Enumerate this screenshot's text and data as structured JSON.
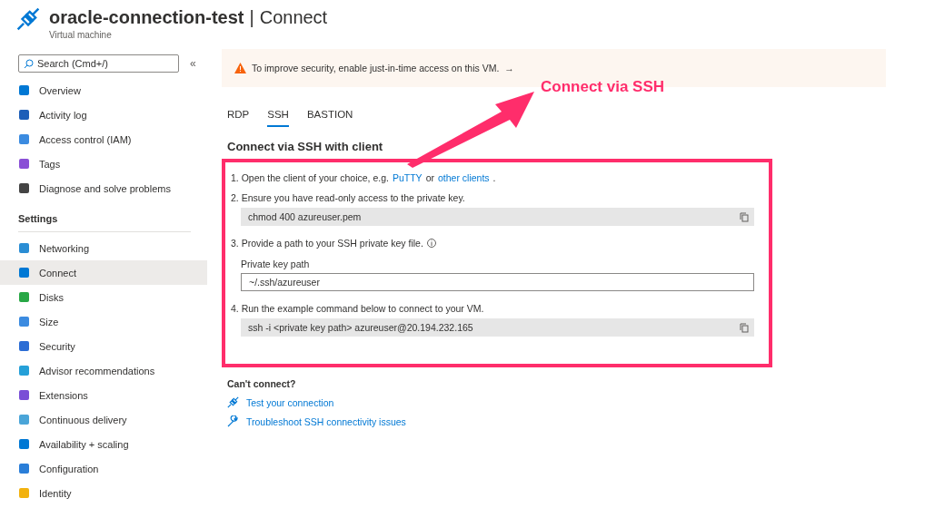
{
  "header": {
    "title": "oracle-connection-test",
    "separator": "|",
    "page": "Connect",
    "subtitle": "Virtual machine"
  },
  "sidebar": {
    "search": {
      "placeholder": "Search (Cmd+/)"
    },
    "collapse": "«",
    "items": [
      {
        "label": "Overview",
        "selected": false
      },
      {
        "label": "Activity log",
        "selected": false
      },
      {
        "label": "Access control (IAM)",
        "selected": false
      },
      {
        "label": "Tags",
        "selected": false
      },
      {
        "label": "Diagnose and solve problems",
        "selected": false
      }
    ],
    "section": "Settings",
    "settings_items": [
      {
        "label": "Networking",
        "selected": false
      },
      {
        "label": "Connect",
        "selected": true
      },
      {
        "label": "Disks",
        "selected": false
      },
      {
        "label": "Size",
        "selected": false
      },
      {
        "label": "Security",
        "selected": false
      },
      {
        "label": "Advisor recommendations",
        "selected": false
      },
      {
        "label": "Extensions",
        "selected": false
      },
      {
        "label": "Continuous delivery",
        "selected": false
      },
      {
        "label": "Availability + scaling",
        "selected": false
      },
      {
        "label": "Configuration",
        "selected": false
      },
      {
        "label": "Identity",
        "selected": false
      }
    ]
  },
  "banner": {
    "text": "To improve security, enable just-in-time access on this VM.",
    "arrow": "→"
  },
  "tabs": [
    {
      "label": "RDP",
      "selected": false
    },
    {
      "label": "SSH",
      "selected": true
    },
    {
      "label": "BASTION",
      "selected": false
    }
  ],
  "heading": "Connect via SSH with client",
  "steps": [
    {
      "kind": "links",
      "text": "1. Open the client of your choice, e.g.",
      "link1": "PuTTY",
      "middle": "or",
      "link2": "other clients",
      "end": "."
    },
    {
      "kind": "code",
      "text": "2. Ensure you have read-only access to the private key.",
      "code": "chmod 400 azureuser.pem"
    },
    {
      "kind": "field",
      "text": "3. Provide a path to your SSH private key file.",
      "field_label": "Private key path",
      "value": "~/.ssh/azureuser"
    },
    {
      "kind": "code",
      "text": "4. Run the example command below to connect to your VM.",
      "code": "ssh -i <private key path> azureuser@20.194.232.165"
    }
  ],
  "help": {
    "title": "Can't connect?",
    "links": [
      "Test your connection",
      "Troubleshoot SSH connectivity issues"
    ]
  },
  "annotation": {
    "text": "Connect via SSH"
  }
}
